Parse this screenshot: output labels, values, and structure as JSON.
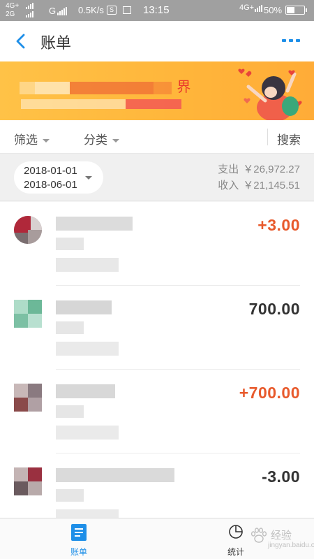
{
  "status_bar": {
    "net1": "4G+",
    "net2": "2G",
    "net3": "G",
    "speed": "0.5K/s",
    "box_icon_text": "S",
    "time": "13:15",
    "net4": "4G+",
    "battery": "50%",
    "battery_level": 0.5
  },
  "nav": {
    "title": "账单"
  },
  "banner": {
    "line1_end": "界"
  },
  "filter": {
    "filter_label": "筛选",
    "category_label": "分类",
    "search_label": "搜索"
  },
  "summary": {
    "start_date": "2018-01-01",
    "end_date": "2018-06-01",
    "expense_label": "支出",
    "expense_value": "￥26,972.27",
    "income_label": "收入",
    "income_value": "￥21,145.51"
  },
  "transactions": [
    {
      "amount": "+3.00",
      "color": "#e85a2c"
    },
    {
      "amount": "700.00",
      "color": "#333333"
    },
    {
      "amount": "+700.00",
      "color": "#e85a2c"
    },
    {
      "amount": "-3.00",
      "color": "#333333"
    }
  ],
  "tabs": {
    "bill_label": "账单",
    "stats_label": "统计"
  },
  "watermark": {
    "text": "经验",
    "url": "jingyan.baidu.com"
  },
  "colors": {
    "accent": "#1e8fe8",
    "income": "#e85a2c",
    "banner": "#ffb53a"
  }
}
